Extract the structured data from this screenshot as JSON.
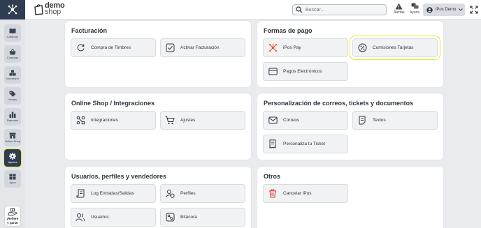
{
  "brand": {
    "line1": "demo",
    "line2": "shop"
  },
  "search": {
    "placeholder": "Buscar..."
  },
  "topbar": {
    "alerts_label": "Alertas",
    "help_label": "Ayuda",
    "user_name": "iPos Demo"
  },
  "sidebar": {
    "items": [
      {
        "label": "Catálogo",
        "icon": "book-icon"
      },
      {
        "label": "Compras",
        "icon": "basket-icon"
      },
      {
        "label": "Inventario",
        "icon": "boxes-icon"
      },
      {
        "label": "Ventas",
        "icon": "tag-icon"
      },
      {
        "label": "Reportes",
        "icon": "bar-chart-icon"
      },
      {
        "label": "Online Shop",
        "icon": "store-icon"
      },
      {
        "label": "Ajustes",
        "icon": "gear-icon"
      },
      {
        "label": "Apps",
        "icon": "apps-icon"
      }
    ],
    "refer": {
      "line1": "¡Refiere",
      "line2": "y gana!"
    }
  },
  "sections": {
    "facturacion": {
      "title": "Facturación",
      "items": [
        {
          "label": "Compra de Timbres"
        },
        {
          "label": "Activar Facturación"
        }
      ]
    },
    "formas_pago": {
      "title": "Formas de pago",
      "items": [
        {
          "label": "iPos Pay"
        },
        {
          "label": "Comisiones Tarjetas"
        },
        {
          "label": "Pagos Electrónicos"
        }
      ]
    },
    "online_shop": {
      "title": "Online Shop / Integraciones",
      "items": [
        {
          "label": "Integraciones"
        },
        {
          "label": "Ajustes"
        }
      ]
    },
    "personalizacion": {
      "title": "Personalización de correos, tickets y documentos",
      "items": [
        {
          "label": "Correos"
        },
        {
          "label": "Textos"
        },
        {
          "label": "Personaliza tu Ticket"
        }
      ]
    },
    "usuarios": {
      "title": "Usuarios, perfiles y vendedores",
      "items": [
        {
          "label": "Log Entradas/Salidas"
        },
        {
          "label": "Perfiles"
        },
        {
          "label": "Usuarios"
        },
        {
          "label": "Bitácora"
        }
      ]
    },
    "otros": {
      "title": "Otros",
      "items": [
        {
          "label": "Cancelar iPos"
        }
      ]
    }
  },
  "colors": {
    "accent": "#2f3d50",
    "highlight": "#e8e62a",
    "danger": "#d63a2f",
    "ipospay": "#e8562a"
  }
}
